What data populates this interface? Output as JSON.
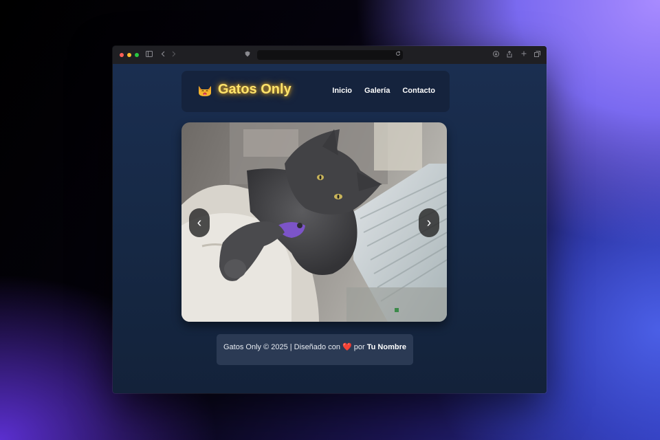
{
  "site": {
    "logo_text": "Gatos Only",
    "logo_icon": "cat-face-emoji",
    "nav": [
      "Inicio",
      "Galería",
      "Contacto"
    ]
  },
  "carousel": {
    "prev_label": "‹",
    "next_label": "›",
    "image": "gray-cat-photo"
  },
  "footer": {
    "text_before": "Gatos Only © 2025 | Diseñado con",
    "heart": "❤️",
    "text_por": "por",
    "author": "Tu Nombre"
  },
  "colors": {
    "logo_glow": "#ffe36a",
    "page_bg": "#162844",
    "footer_bg": "#2b3a54"
  }
}
